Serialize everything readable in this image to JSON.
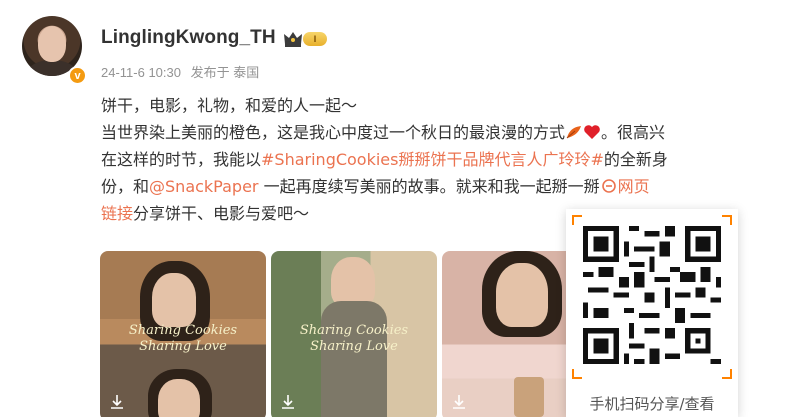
{
  "user": {
    "name": "LinglingKwong_TH",
    "level": "I",
    "verified_mark": "v"
  },
  "meta": {
    "date": "24-11-6 10:30",
    "source": "发布于 泰国"
  },
  "post": {
    "line1": "饼干，电影，礼物，和爱的人一起～",
    "line2_a": "当世界染上美丽的橙色，这是我心中度过一个秋日的最浪漫的方式",
    "line2_b": "。很高兴",
    "line3_a": "在这样的时节，我能以",
    "hashtag": "#SharingCookies掰掰饼干品牌代言人广玲玲#",
    "line3_b": "的全新身",
    "line4_a": "份，和",
    "mention": "@SnackPaper",
    "line4_b": " 一起再度续写美丽的故事。就来和我一起掰一掰",
    "weblink_a": "网页",
    "weblink_b": "链接",
    "line5": "分享饼干、电影与爱吧～"
  },
  "icons": {
    "leaf": "maple-leaf-icon",
    "heart": "red-heart-icon",
    "crown": "crown-icon",
    "download": "download-icon",
    "link": "link-icon"
  },
  "thumbnails": [
    {
      "caption_line1": "Sharing Cookies",
      "caption_line2": "Sharing Love"
    },
    {
      "caption_line1": "Sharing Cookies",
      "caption_line2": "Sharing Love"
    },
    {
      "caption_line1": "",
      "caption_line2": ""
    }
  ],
  "qr_popup": {
    "caption": "手机扫码分享/查看"
  },
  "colors": {
    "link": "#eb7350",
    "accent": "#ff8200",
    "meta": "#939393"
  }
}
